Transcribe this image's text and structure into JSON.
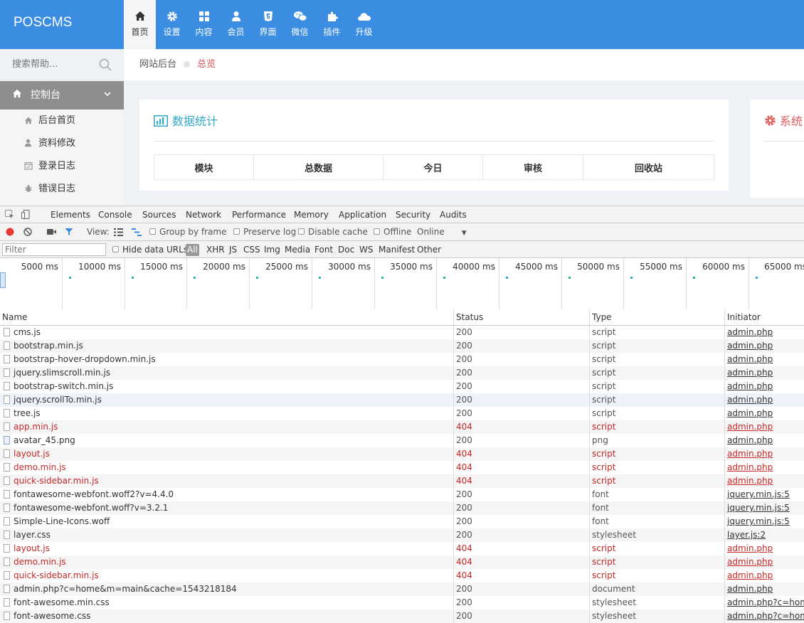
{
  "app": {
    "logo": "POSCMS"
  },
  "topnav": [
    {
      "label": "首页",
      "icon": "home-icon",
      "active": true
    },
    {
      "label": "设置",
      "icon": "gear-icon"
    },
    {
      "label": "内容",
      "icon": "grid-icon"
    },
    {
      "label": "会员",
      "icon": "user-icon"
    },
    {
      "label": "界面",
      "icon": "html5-icon"
    },
    {
      "label": "微信",
      "icon": "wechat-icon"
    },
    {
      "label": "插件",
      "icon": "puzzle-icon"
    },
    {
      "label": "升级",
      "icon": "cloud-icon"
    }
  ],
  "sidebar": {
    "search_placeholder": "搜索帮助...",
    "section": "控制台",
    "items": [
      {
        "label": "后台首页",
        "icon": "home-icon"
      },
      {
        "label": "资料修改",
        "icon": "user-icon"
      },
      {
        "label": "登录日志",
        "icon": "calendar-icon"
      },
      {
        "label": "错误日志",
        "icon": "bug-icon"
      }
    ]
  },
  "breadcrumb": {
    "home": "网站后台",
    "current": "总览"
  },
  "stats_panel": {
    "title": "数据统计",
    "columns": [
      "模块",
      "总数据",
      "今日",
      "审核",
      "回收站"
    ]
  },
  "system_panel": {
    "title": "系统"
  },
  "devtools": {
    "tabs": [
      "Elements",
      "Console",
      "Sources",
      "Network",
      "Performance",
      "Memory",
      "Application",
      "Security",
      "Audits"
    ],
    "active_tab": "Network",
    "toolbar": {
      "view_label": "View:",
      "group_by_frame": "Group by frame",
      "preserve_log": "Preserve log",
      "disable_cache": "Disable cache",
      "offline": "Offline",
      "throttle": "Online"
    },
    "filter": {
      "placeholder": "Filter",
      "hide_data_urls": "Hide data URLs",
      "types": [
        "All",
        "XHR",
        "JS",
        "CSS",
        "Img",
        "Media",
        "Font",
        "Doc",
        "WS",
        "Manifest",
        "Other"
      ]
    },
    "timeline_labels": [
      "5000 ms",
      "10000 ms",
      "15000 ms",
      "20000 ms",
      "25000 ms",
      "30000 ms",
      "35000 ms",
      "40000 ms",
      "45000 ms",
      "50000 ms",
      "55000 ms",
      "60000 ms",
      "65000 ms"
    ],
    "columns": [
      "Name",
      "Status",
      "Type",
      "Initiator"
    ],
    "requests": [
      {
        "name": "cms.js",
        "status": "200",
        "type": "script",
        "initiator": "admin.php"
      },
      {
        "name": "bootstrap.min.js",
        "status": "200",
        "type": "script",
        "initiator": "admin.php"
      },
      {
        "name": "bootstrap-hover-dropdown.min.js",
        "status": "200",
        "type": "script",
        "initiator": "admin.php"
      },
      {
        "name": "jquery.slimscroll.min.js",
        "status": "200",
        "type": "script",
        "initiator": "admin.php"
      },
      {
        "name": "bootstrap-switch.min.js",
        "status": "200",
        "type": "script",
        "initiator": "admin.php"
      },
      {
        "name": "jquery.scrollTo.min.js",
        "status": "200",
        "type": "script",
        "initiator": "admin.php"
      },
      {
        "name": "tree.js",
        "status": "200",
        "type": "script",
        "initiator": "admin.php"
      },
      {
        "name": "app.min.js",
        "status": "404",
        "type": "script",
        "initiator": "admin.php"
      },
      {
        "name": "avatar_45.png",
        "status": "200",
        "type": "png",
        "initiator": "admin.php"
      },
      {
        "name": "layout.js",
        "status": "404",
        "type": "script",
        "initiator": "admin.php"
      },
      {
        "name": "demo.min.js",
        "status": "404",
        "type": "script",
        "initiator": "admin.php"
      },
      {
        "name": "quick-sidebar.min.js",
        "status": "404",
        "type": "script",
        "initiator": "admin.php"
      },
      {
        "name": "fontawesome-webfont.woff2?v=4.4.0",
        "status": "200",
        "type": "font",
        "initiator": "jquery.min.js:5"
      },
      {
        "name": "fontawesome-webfont.woff?v=3.2.1",
        "status": "200",
        "type": "font",
        "initiator": "jquery.min.js:5"
      },
      {
        "name": "Simple-Line-Icons.woff",
        "status": "200",
        "type": "font",
        "initiator": "jquery.min.js:5"
      },
      {
        "name": "layer.css",
        "status": "200",
        "type": "stylesheet",
        "initiator": "layer.js:2"
      },
      {
        "name": "layout.js",
        "status": "404",
        "type": "script",
        "initiator": "admin.php"
      },
      {
        "name": "demo.min.js",
        "status": "404",
        "type": "script",
        "initiator": "admin.php"
      },
      {
        "name": "quick-sidebar.min.js",
        "status": "404",
        "type": "script",
        "initiator": "admin.php"
      },
      {
        "name": "admin.php?c=home&m=main&cache=1543218184",
        "status": "200",
        "type": "document",
        "initiator": "admin.php"
      },
      {
        "name": "font-awesome.min.css",
        "status": "200",
        "type": "stylesheet",
        "initiator": "admin.php?c=home&m=main"
      },
      {
        "name": "font-awesome.css",
        "status": "200",
        "type": "stylesheet",
        "initiator": "admin.php?c=home&m=main"
      }
    ]
  },
  "colors": {
    "brand": "#3a8de1",
    "error": "#c62828",
    "accent_teal": "#32a8c7"
  }
}
